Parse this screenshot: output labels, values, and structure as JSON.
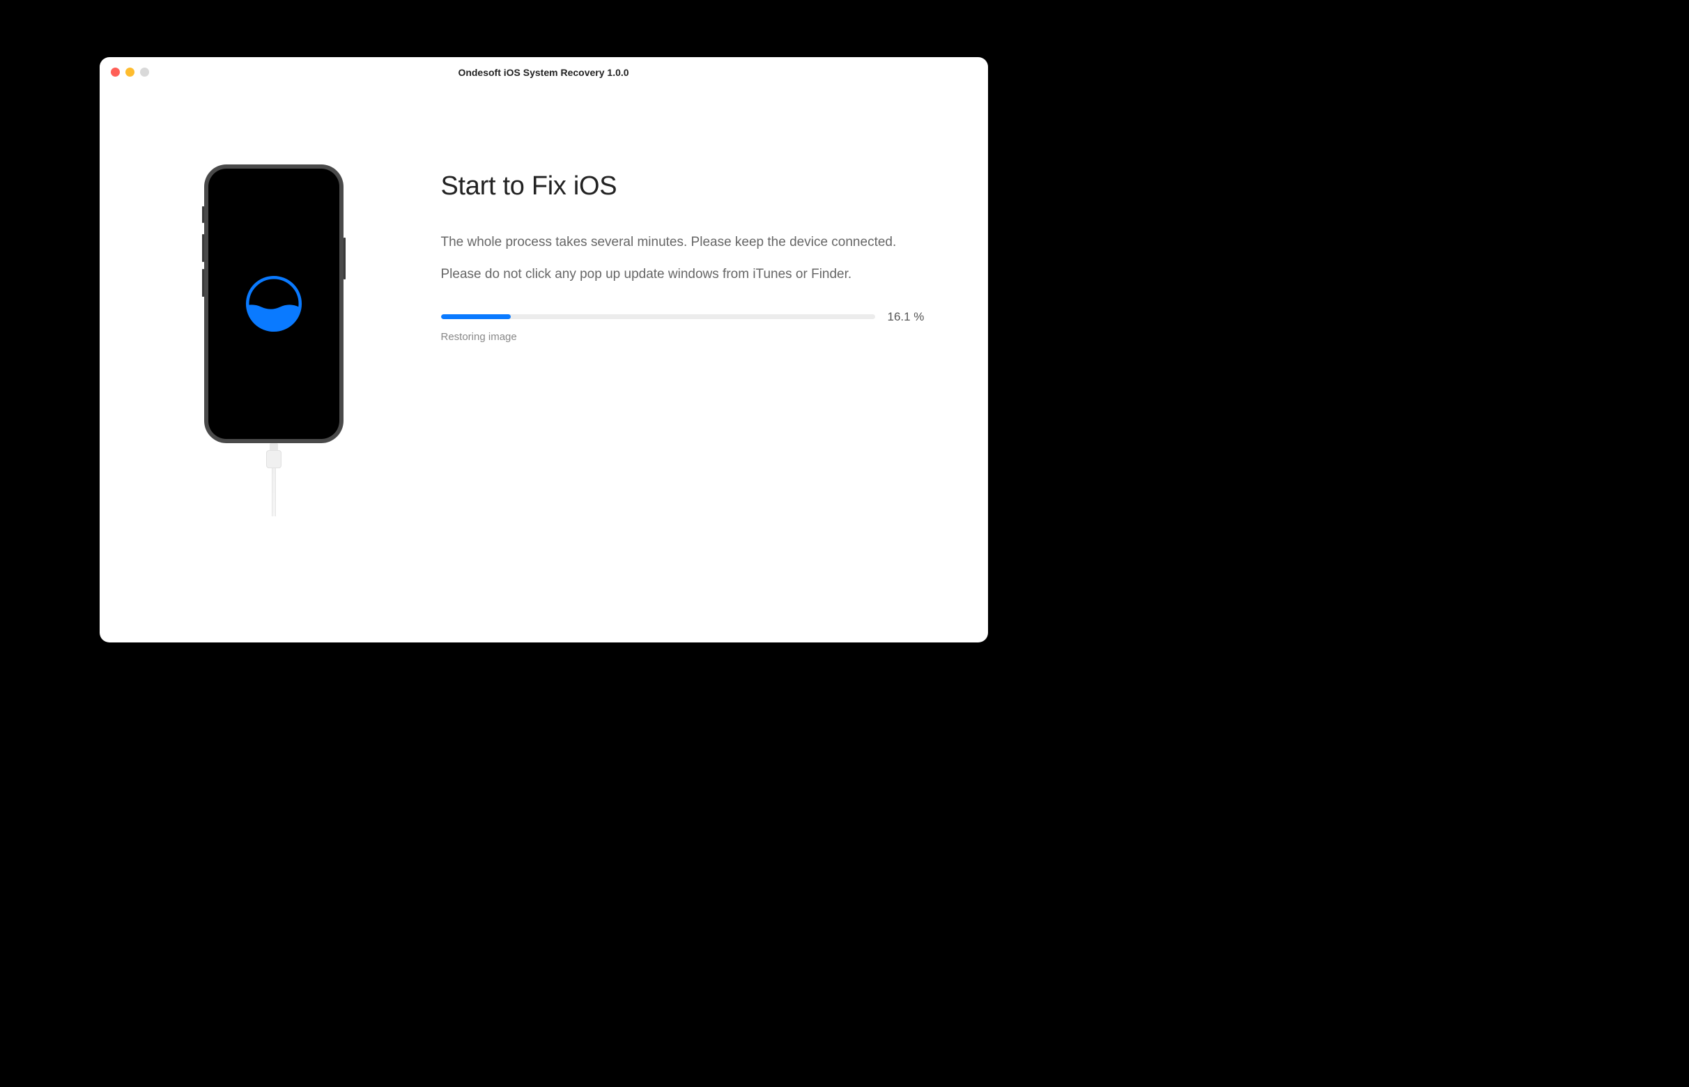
{
  "window": {
    "title": "Ondesoft iOS System Recovery 1.0.0"
  },
  "main": {
    "heading": "Start to Fix iOS",
    "description1": "The whole process takes several minutes. Please keep the device connected.",
    "description2": "Please do not click any pop up update windows from iTunes or Finder.",
    "progress": {
      "percent": 16.1,
      "percent_label": "16.1 %",
      "status": "Restoring image"
    }
  },
  "colors": {
    "accent": "#0a7aff"
  }
}
